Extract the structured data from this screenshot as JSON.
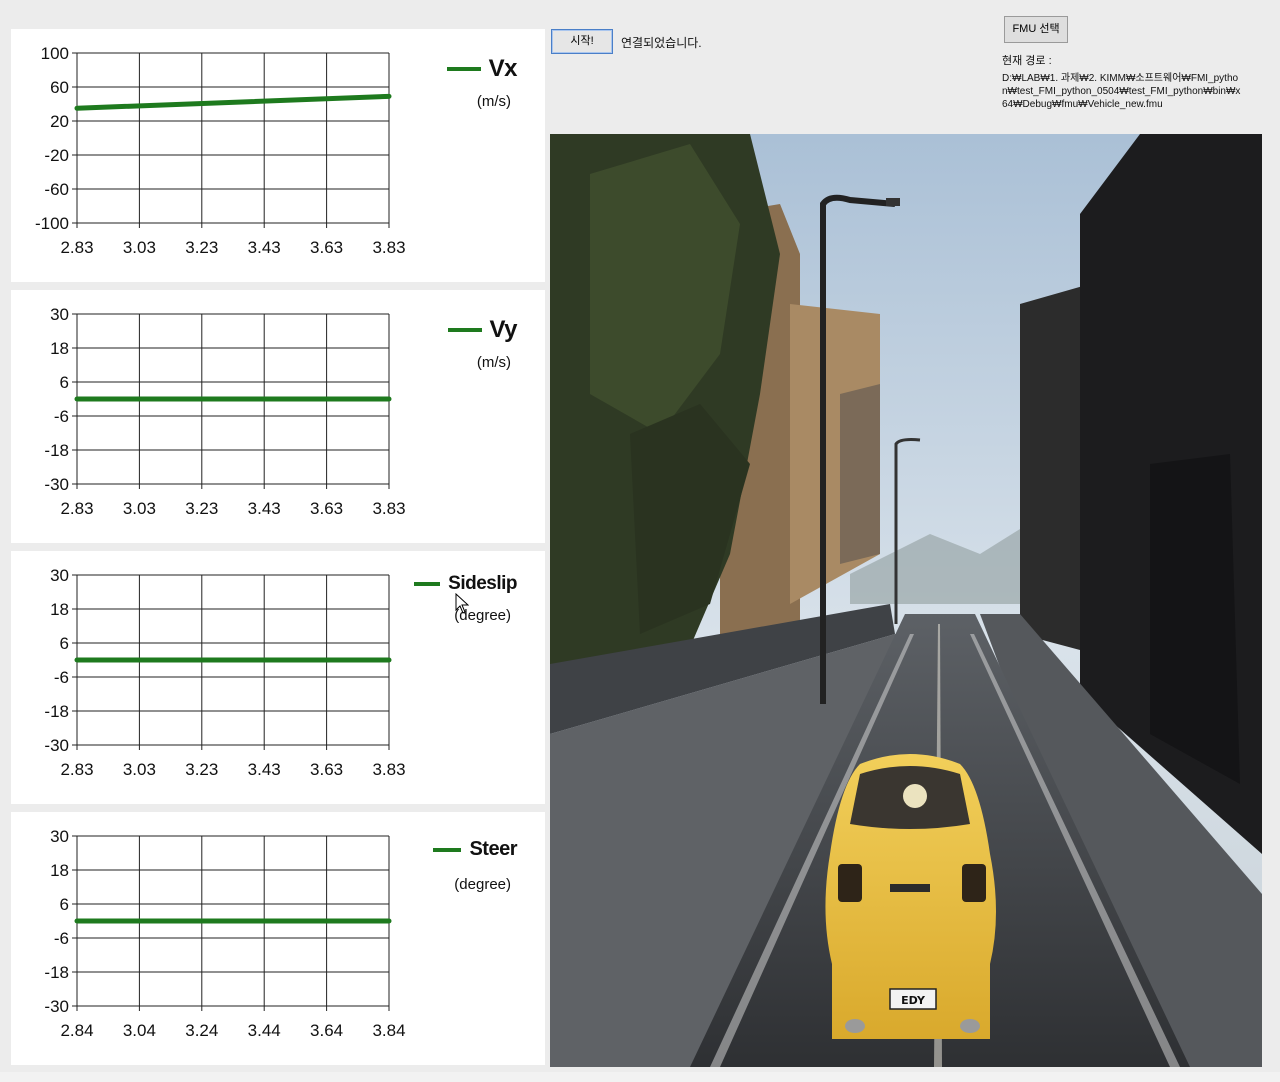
{
  "controls": {
    "start_label": "시작!",
    "status_text": "연결되었습니다.",
    "fmu_select_label": "FMU 선택",
    "path_label": "현재 경로 :",
    "path_value": "D:₩LAB₩1. 과제₩2. KIMM₩소프트웨어₩FMI_python₩test_FMI_python_0504₩test_FMI_python₩bin₩x64₩Debug₩fmu₩Vehicle_new.fmu"
  },
  "colors": {
    "series": "#1e7a1e",
    "panel_bg": "#ffffff",
    "window_bg": "#ececec",
    "button_border": "#4a7fc8"
  },
  "viewport": {
    "content": "3D driving simulation: yellow sports car on a street between buildings",
    "plate_text": "EDY"
  },
  "chart_data": [
    {
      "type": "line",
      "series": [
        {
          "name": "Vx",
          "x": [
            2.83,
            3.83
          ],
          "values": [
            35,
            49
          ]
        }
      ],
      "legend": "Vx",
      "unit": "(m/s)",
      "x_ticks": [
        "2.83",
        "3.03",
        "3.23",
        "3.43",
        "3.63",
        "3.83"
      ],
      "y_ticks": [
        "100",
        "60",
        "20",
        "-20",
        "-60",
        "-100"
      ],
      "xlim": [
        2.83,
        3.83
      ],
      "ylim": [
        -100,
        100
      ],
      "grid": true,
      "legend_position": "top-right"
    },
    {
      "type": "line",
      "series": [
        {
          "name": "Vy",
          "x": [
            2.83,
            3.83
          ],
          "values": [
            0,
            0
          ]
        }
      ],
      "legend": "Vy",
      "unit": "(m/s)",
      "x_ticks": [
        "2.83",
        "3.03",
        "3.23",
        "3.43",
        "3.63",
        "3.83"
      ],
      "y_ticks": [
        "30",
        "18",
        "6",
        "-6",
        "-18",
        "-30"
      ],
      "xlim": [
        2.83,
        3.83
      ],
      "ylim": [
        -30,
        30
      ],
      "grid": true,
      "legend_position": "top-right"
    },
    {
      "type": "line",
      "series": [
        {
          "name": "Sideslip",
          "x": [
            2.83,
            3.83
          ],
          "values": [
            0,
            0
          ]
        }
      ],
      "legend": "Sideslip",
      "unit": "(degree)",
      "x_ticks": [
        "2.83",
        "3.03",
        "3.23",
        "3.43",
        "3.63",
        "3.83"
      ],
      "y_ticks": [
        "30",
        "18",
        "6",
        "-6",
        "-18",
        "-30"
      ],
      "xlim": [
        2.83,
        3.83
      ],
      "ylim": [
        -30,
        30
      ],
      "grid": true,
      "legend_position": "top-right"
    },
    {
      "type": "line",
      "series": [
        {
          "name": "Steer",
          "x": [
            2.84,
            3.84
          ],
          "values": [
            0,
            0
          ]
        }
      ],
      "legend": "Steer",
      "unit": "(degree)",
      "x_ticks": [
        "2.84",
        "3.04",
        "3.24",
        "3.44",
        "3.64",
        "3.84"
      ],
      "y_ticks": [
        "30",
        "18",
        "6",
        "-6",
        "-18",
        "-30"
      ],
      "xlim": [
        2.84,
        3.84
      ],
      "ylim": [
        -30,
        30
      ],
      "grid": true,
      "legend_position": "top-right"
    }
  ]
}
